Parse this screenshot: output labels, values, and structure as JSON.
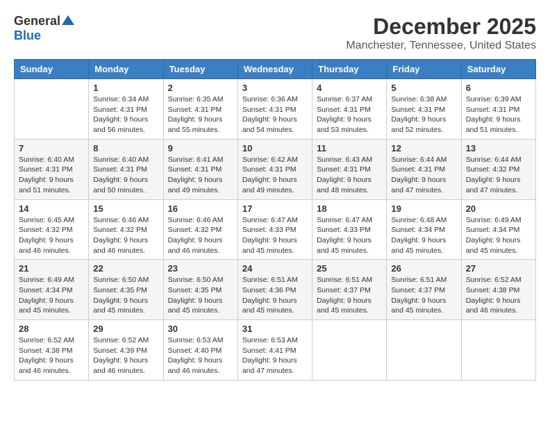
{
  "header": {
    "logo_general": "General",
    "logo_blue": "Blue",
    "title": "December 2025",
    "subtitle": "Manchester, Tennessee, United States"
  },
  "days_of_week": [
    "Sunday",
    "Monday",
    "Tuesday",
    "Wednesday",
    "Thursday",
    "Friday",
    "Saturday"
  ],
  "weeks": [
    [
      {
        "day": "",
        "sunrise": "",
        "sunset": "",
        "daylight": "",
        "empty": true
      },
      {
        "day": "1",
        "sunrise": "Sunrise: 6:34 AM",
        "sunset": "Sunset: 4:31 PM",
        "daylight": "Daylight: 9 hours and 56 minutes."
      },
      {
        "day": "2",
        "sunrise": "Sunrise: 6:35 AM",
        "sunset": "Sunset: 4:31 PM",
        "daylight": "Daylight: 9 hours and 55 minutes."
      },
      {
        "day": "3",
        "sunrise": "Sunrise: 6:36 AM",
        "sunset": "Sunset: 4:31 PM",
        "daylight": "Daylight: 9 hours and 54 minutes."
      },
      {
        "day": "4",
        "sunrise": "Sunrise: 6:37 AM",
        "sunset": "Sunset: 4:31 PM",
        "daylight": "Daylight: 9 hours and 53 minutes."
      },
      {
        "day": "5",
        "sunrise": "Sunrise: 6:38 AM",
        "sunset": "Sunset: 4:31 PM",
        "daylight": "Daylight: 9 hours and 52 minutes."
      },
      {
        "day": "6",
        "sunrise": "Sunrise: 6:39 AM",
        "sunset": "Sunset: 4:31 PM",
        "daylight": "Daylight: 9 hours and 51 minutes."
      }
    ],
    [
      {
        "day": "7",
        "sunrise": "Sunrise: 6:40 AM",
        "sunset": "Sunset: 4:31 PM",
        "daylight": "Daylight: 9 hours and 51 minutes."
      },
      {
        "day": "8",
        "sunrise": "Sunrise: 6:40 AM",
        "sunset": "Sunset: 4:31 PM",
        "daylight": "Daylight: 9 hours and 50 minutes."
      },
      {
        "day": "9",
        "sunrise": "Sunrise: 6:41 AM",
        "sunset": "Sunset: 4:31 PM",
        "daylight": "Daylight: 9 hours and 49 minutes."
      },
      {
        "day": "10",
        "sunrise": "Sunrise: 6:42 AM",
        "sunset": "Sunset: 4:31 PM",
        "daylight": "Daylight: 9 hours and 49 minutes."
      },
      {
        "day": "11",
        "sunrise": "Sunrise: 6:43 AM",
        "sunset": "Sunset: 4:31 PM",
        "daylight": "Daylight: 9 hours and 48 minutes."
      },
      {
        "day": "12",
        "sunrise": "Sunrise: 6:44 AM",
        "sunset": "Sunset: 4:31 PM",
        "daylight": "Daylight: 9 hours and 47 minutes."
      },
      {
        "day": "13",
        "sunrise": "Sunrise: 6:44 AM",
        "sunset": "Sunset: 4:32 PM",
        "daylight": "Daylight: 9 hours and 47 minutes."
      }
    ],
    [
      {
        "day": "14",
        "sunrise": "Sunrise: 6:45 AM",
        "sunset": "Sunset: 4:32 PM",
        "daylight": "Daylight: 9 hours and 46 minutes."
      },
      {
        "day": "15",
        "sunrise": "Sunrise: 6:46 AM",
        "sunset": "Sunset: 4:32 PM",
        "daylight": "Daylight: 9 hours and 46 minutes."
      },
      {
        "day": "16",
        "sunrise": "Sunrise: 6:46 AM",
        "sunset": "Sunset: 4:32 PM",
        "daylight": "Daylight: 9 hours and 46 minutes."
      },
      {
        "day": "17",
        "sunrise": "Sunrise: 6:47 AM",
        "sunset": "Sunset: 4:33 PM",
        "daylight": "Daylight: 9 hours and 45 minutes."
      },
      {
        "day": "18",
        "sunrise": "Sunrise: 6:47 AM",
        "sunset": "Sunset: 4:33 PM",
        "daylight": "Daylight: 9 hours and 45 minutes."
      },
      {
        "day": "19",
        "sunrise": "Sunrise: 6:48 AM",
        "sunset": "Sunset: 4:34 PM",
        "daylight": "Daylight: 9 hours and 45 minutes."
      },
      {
        "day": "20",
        "sunrise": "Sunrise: 6:49 AM",
        "sunset": "Sunset: 4:34 PM",
        "daylight": "Daylight: 9 hours and 45 minutes."
      }
    ],
    [
      {
        "day": "21",
        "sunrise": "Sunrise: 6:49 AM",
        "sunset": "Sunset: 4:34 PM",
        "daylight": "Daylight: 9 hours and 45 minutes."
      },
      {
        "day": "22",
        "sunrise": "Sunrise: 6:50 AM",
        "sunset": "Sunset: 4:35 PM",
        "daylight": "Daylight: 9 hours and 45 minutes."
      },
      {
        "day": "23",
        "sunrise": "Sunrise: 6:50 AM",
        "sunset": "Sunset: 4:35 PM",
        "daylight": "Daylight: 9 hours and 45 minutes."
      },
      {
        "day": "24",
        "sunrise": "Sunrise: 6:51 AM",
        "sunset": "Sunset: 4:36 PM",
        "daylight": "Daylight: 9 hours and 45 minutes."
      },
      {
        "day": "25",
        "sunrise": "Sunrise: 6:51 AM",
        "sunset": "Sunset: 4:37 PM",
        "daylight": "Daylight: 9 hours and 45 minutes."
      },
      {
        "day": "26",
        "sunrise": "Sunrise: 6:51 AM",
        "sunset": "Sunset: 4:37 PM",
        "daylight": "Daylight: 9 hours and 45 minutes."
      },
      {
        "day": "27",
        "sunrise": "Sunrise: 6:52 AM",
        "sunset": "Sunset: 4:38 PM",
        "daylight": "Daylight: 9 hours and 46 minutes."
      }
    ],
    [
      {
        "day": "28",
        "sunrise": "Sunrise: 6:52 AM",
        "sunset": "Sunset: 4:38 PM",
        "daylight": "Daylight: 9 hours and 46 minutes."
      },
      {
        "day": "29",
        "sunrise": "Sunrise: 6:52 AM",
        "sunset": "Sunset: 4:39 PM",
        "daylight": "Daylight: 9 hours and 46 minutes."
      },
      {
        "day": "30",
        "sunrise": "Sunrise: 6:53 AM",
        "sunset": "Sunset: 4:40 PM",
        "daylight": "Daylight: 9 hours and 46 minutes."
      },
      {
        "day": "31",
        "sunrise": "Sunrise: 6:53 AM",
        "sunset": "Sunset: 4:41 PM",
        "daylight": "Daylight: 9 hours and 47 minutes."
      },
      {
        "day": "",
        "sunrise": "",
        "sunset": "",
        "daylight": "",
        "empty": true
      },
      {
        "day": "",
        "sunrise": "",
        "sunset": "",
        "daylight": "",
        "empty": true
      },
      {
        "day": "",
        "sunrise": "",
        "sunset": "",
        "daylight": "",
        "empty": true
      }
    ]
  ]
}
